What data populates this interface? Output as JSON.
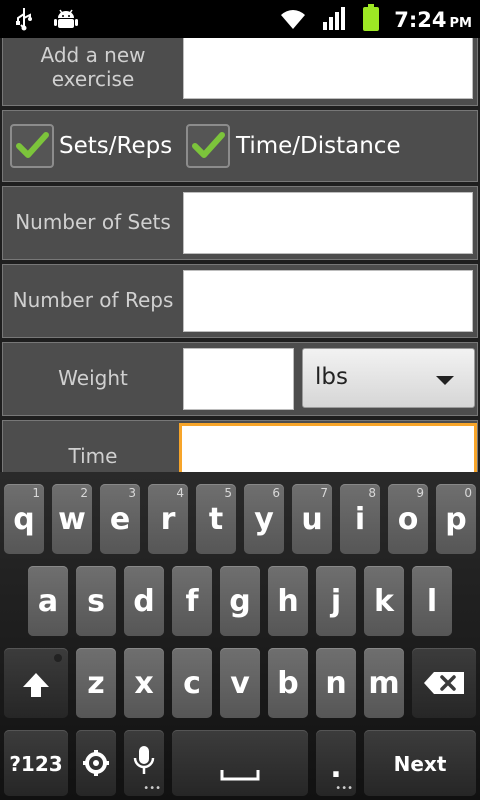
{
  "form": {
    "add_exercise_label": "Add a new exercise",
    "checkbox_sets_reps": "Sets/Reps",
    "checkbox_time_distance": "Time/Distance",
    "sets_label": "Number of Sets",
    "reps_label": "Number of Reps",
    "weight_label": "Weight",
    "weight_unit": "lbs",
    "time_label": "Time"
  },
  "status_bar": {
    "time": "7:24",
    "ampm": "PM"
  },
  "keyboard": {
    "row1": [
      {
        "letter": "q",
        "num": "1"
      },
      {
        "letter": "w",
        "num": "2"
      },
      {
        "letter": "e",
        "num": "3"
      },
      {
        "letter": "r",
        "num": "4"
      },
      {
        "letter": "t",
        "num": "5"
      },
      {
        "letter": "y",
        "num": "6"
      },
      {
        "letter": "u",
        "num": "7"
      },
      {
        "letter": "i",
        "num": "8"
      },
      {
        "letter": "o",
        "num": "9"
      },
      {
        "letter": "p",
        "num": "0"
      }
    ],
    "row2": [
      "a",
      "s",
      "d",
      "f",
      "g",
      "h",
      "j",
      "k",
      "l"
    ],
    "row3": [
      "z",
      "x",
      "c",
      "v",
      "b",
      "n",
      "m"
    ],
    "symbols_label": "?123",
    "period_label": ".",
    "next_label": "Next"
  },
  "colors": {
    "focus_border": "#f7a52a",
    "check_green": "#7cc43b",
    "battery_green": "#9ee824"
  }
}
